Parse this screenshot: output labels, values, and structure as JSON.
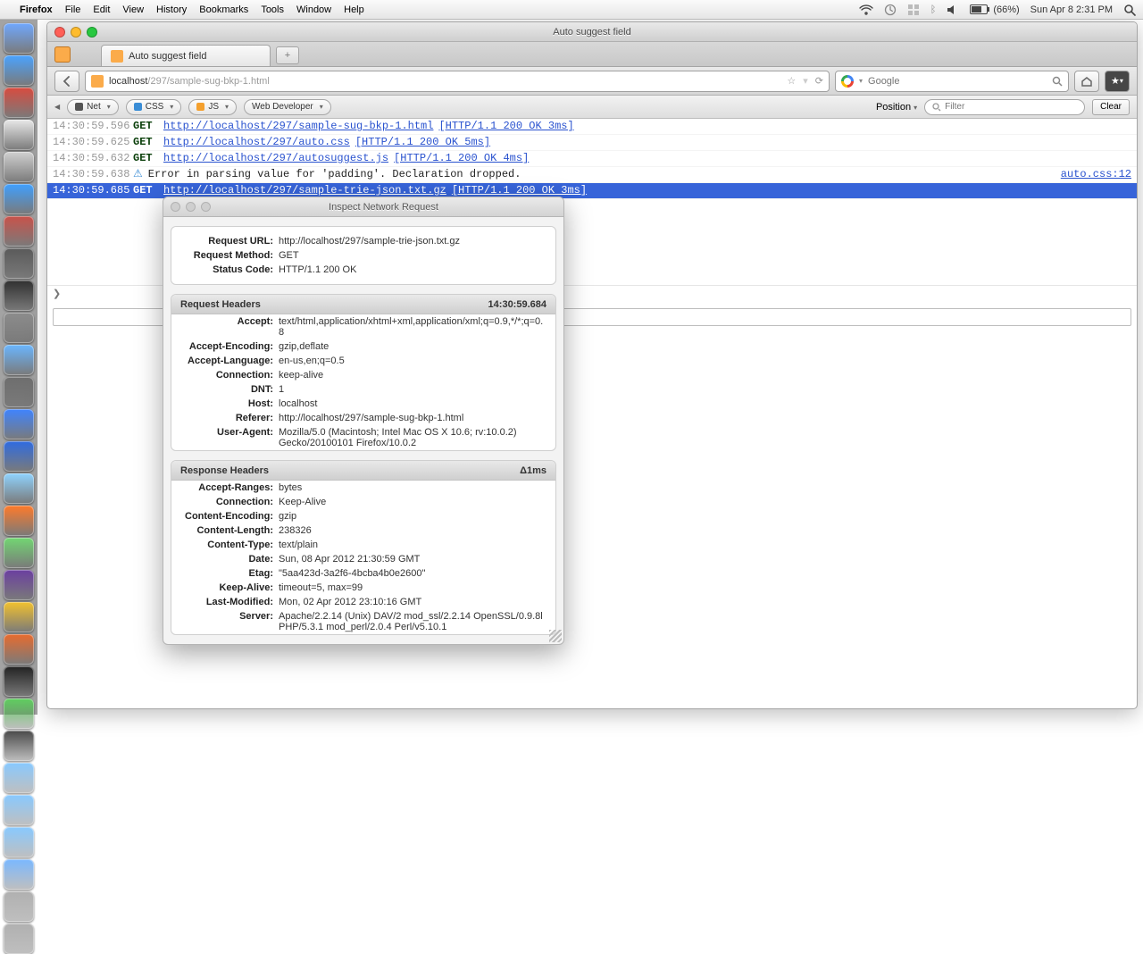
{
  "menubar": {
    "app": "Firefox",
    "items": [
      "File",
      "Edit",
      "View",
      "History",
      "Bookmarks",
      "Tools",
      "Window",
      "Help"
    ],
    "battery": "(66%)",
    "clock": "Sun Apr 8  2:31 PM"
  },
  "window": {
    "title": "Auto suggest field"
  },
  "tab": {
    "label": "Auto suggest field"
  },
  "url": {
    "domain": "localhost",
    "path": "/297/sample-sug-bkp-1.html"
  },
  "search": {
    "placeholder": "Google"
  },
  "firebug": {
    "panels": {
      "net": "Net",
      "css": "CSS",
      "js": "JS",
      "wd": "Web Developer"
    },
    "position": "Position",
    "filter": "Filter",
    "clear": "Clear"
  },
  "log": [
    {
      "ts": "14:30:59.596",
      "method": "GET",
      "url": "http://localhost/297/sample-sug-bkp-1.html",
      "status": "[HTTP/1.1 200 OK 3ms]"
    },
    {
      "ts": "14:30:59.625",
      "method": "GET",
      "url": "http://localhost/297/auto.css",
      "status": "[HTTP/1.1 200 OK 5ms]"
    },
    {
      "ts": "14:30:59.632",
      "method": "GET",
      "url": "http://localhost/297/autosuggest.js",
      "status": "[HTTP/1.1 200 OK 4ms]"
    },
    {
      "ts": "14:30:59.638",
      "warn": true,
      "msg": "Error in parsing value for 'padding'.  Declaration dropped.",
      "src": "auto.css:12"
    },
    {
      "ts": "14:30:59.685",
      "method": "GET",
      "url": "http://localhost/297/sample-trie-json.txt.gz",
      "status": "[HTTP/1.1 200 OK 3ms]",
      "selected": true
    }
  ],
  "inspector": {
    "title": "Inspect Network Request",
    "summary": [
      {
        "k": "Request URL:",
        "v": "http://localhost/297/sample-trie-json.txt.gz"
      },
      {
        "k": "Request Method:",
        "v": "GET"
      },
      {
        "k": "Status Code:",
        "v": "HTTP/1.1 200 OK"
      }
    ],
    "req_head_title": "Request Headers",
    "req_head_ts": "14:30:59.684",
    "request_headers": [
      {
        "k": "Accept:",
        "v": "text/html,application/xhtml+xml,application/xml;q=0.9,*/*;q=0.8"
      },
      {
        "k": "Accept-Encoding:",
        "v": "gzip,deflate"
      },
      {
        "k": "Accept-Language:",
        "v": "en-us,en;q=0.5"
      },
      {
        "k": "Connection:",
        "v": "keep-alive"
      },
      {
        "k": "DNT:",
        "v": "1"
      },
      {
        "k": "Host:",
        "v": "localhost"
      },
      {
        "k": "Referer:",
        "v": "http://localhost/297/sample-sug-bkp-1.html"
      },
      {
        "k": "User-Agent:",
        "v": "Mozilla/5.0 (Macintosh; Intel Mac OS X 10.6; rv:10.0.2) Gecko/20100101 Firefox/10.0.2"
      }
    ],
    "resp_head_title": "Response Headers",
    "resp_head_delta": "Δ1ms",
    "response_headers": [
      {
        "k": "Accept-Ranges:",
        "v": "bytes"
      },
      {
        "k": "Connection:",
        "v": "Keep-Alive"
      },
      {
        "k": "Content-Encoding:",
        "v": "gzip"
      },
      {
        "k": "Content-Length:",
        "v": "238326"
      },
      {
        "k": "Content-Type:",
        "v": "text/plain"
      },
      {
        "k": "Date:",
        "v": "Sun, 08 Apr 2012 21:30:59 GMT"
      },
      {
        "k": "Etag:",
        "v": "\"5aa423d-3a2f6-4bcba4b0e2600\""
      },
      {
        "k": "Keep-Alive:",
        "v": "timeout=5, max=99"
      },
      {
        "k": "Last-Modified:",
        "v": "Mon, 02 Apr 2012 23:10:16 GMT"
      },
      {
        "k": "Server:",
        "v": "Apache/2.2.14 (Unix) DAV/2 mod_ssl/2.2.14 OpenSSL/0.9.8l PHP/5.3.1 mod_perl/2.0.4 Perl/v5.10.1"
      }
    ]
  },
  "dock_colors": [
    "#6fa8ff",
    "#4aa3ff",
    "#d84b3f",
    "#e8e8e8",
    "#d0d0d0",
    "#3fa0ff",
    "#c9524a",
    "#5a5a5a",
    "#303030",
    "#8c8c8c",
    "#6ab6ff",
    "#6e6e6e",
    "#3f84ff",
    "#2f6be0",
    "#8fd3ff",
    "#ff7a2a",
    "#72d672",
    "#6b3fa0",
    "#f2c12e",
    "#e86b2e",
    "#222222",
    "#5fcf5f",
    "#4a4a4a",
    "#88c9ff",
    "#88c9ff",
    "#88c9ff",
    "#7ab8ff",
    "#b0b0b0",
    "#b0b0b0"
  ]
}
